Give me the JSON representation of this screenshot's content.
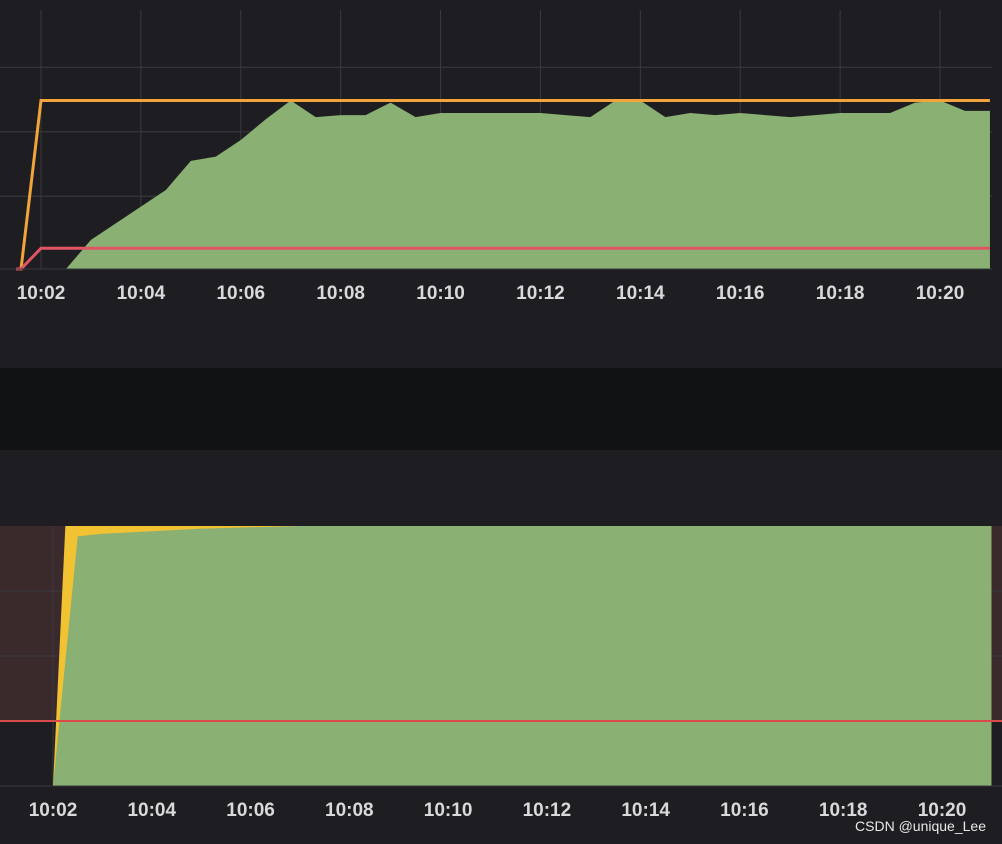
{
  "watermark": "CSDN @unique_Lee",
  "colors": {
    "background": "#1e1e22",
    "separator": "#111214",
    "grid": "#3a3b3f",
    "area_green": "#8bb073",
    "line_orange": "#f2a33b",
    "line_red": "#e05463",
    "area_yellow": "#f1c232",
    "threshold_bg": "#3a2a2c",
    "threshold_red": "#d94a4a"
  },
  "chart_data": [
    {
      "type": "area",
      "title": "",
      "x_tick_labels": [
        "10:02",
        "10:04",
        "10:06",
        "10:08",
        "10:10",
        "10:12",
        "10:14",
        "10:16",
        "10:18",
        "10:20"
      ],
      "xlim": [
        2.0,
        21.0
      ],
      "ylim": [
        0,
        100
      ],
      "grid": true,
      "series": [
        {
          "kind": "area",
          "color": "#8bb073",
          "x": [
            1.5,
            2.5,
            3.0,
            3.5,
            4.0,
            4.5,
            5.0,
            5.5,
            6.0,
            6.5,
            7.0,
            7.5,
            8.0,
            8.5,
            9.0,
            9.5,
            10.0,
            10.5,
            11.0,
            11.5,
            12.0,
            12.5,
            13.0,
            13.5,
            14.0,
            14.5,
            15.0,
            15.5,
            16.0,
            16.5,
            17.0,
            17.5,
            18.0,
            18.5,
            19.0,
            19.5,
            20.0,
            20.5,
            21.0
          ],
          "y": [
            0,
            0,
            14,
            22,
            30,
            38,
            52,
            54,
            62,
            72,
            81,
            73,
            74,
            74,
            80,
            73,
            75,
            75,
            75,
            75,
            75,
            74,
            73,
            81,
            81,
            73,
            75,
            74,
            75,
            74,
            73,
            74,
            75,
            75,
            75,
            80,
            81,
            76,
            76
          ]
        },
        {
          "kind": "line",
          "color": "#f2a33b",
          "x": [
            1.5,
            1.6,
            2.0,
            21.0
          ],
          "y": [
            0,
            0,
            81,
            81
          ]
        },
        {
          "kind": "line",
          "color": "#e05463",
          "x": [
            1.5,
            1.6,
            2.0,
            21.0
          ],
          "y": [
            0,
            0,
            10,
            10
          ]
        }
      ]
    },
    {
      "type": "area",
      "title": "",
      "x_tick_labels": [
        "10:02",
        "10:04",
        "10:06",
        "10:08",
        "10:10",
        "10:12",
        "10:14",
        "10:16",
        "10:18",
        "10:20"
      ],
      "xlim": [
        2.0,
        21.0
      ],
      "ylim": [
        0,
        100
      ],
      "grid": true,
      "threshold": 25,
      "series": [
        {
          "kind": "area",
          "color": "#f1c232",
          "x": [
            2.0,
            2.25,
            2.6,
            3.0,
            4.0,
            5.0,
            21.0
          ],
          "y": [
            0,
            100,
            100,
            100,
            100,
            100,
            100
          ]
        },
        {
          "kind": "area",
          "color": "#8bb073",
          "x": [
            2.0,
            2.5,
            3.0,
            4.0,
            5.0,
            6.0,
            7.0,
            21.0
          ],
          "y": [
            0,
            96,
            97,
            98,
            99,
            99.5,
            100,
            100
          ]
        }
      ]
    }
  ]
}
